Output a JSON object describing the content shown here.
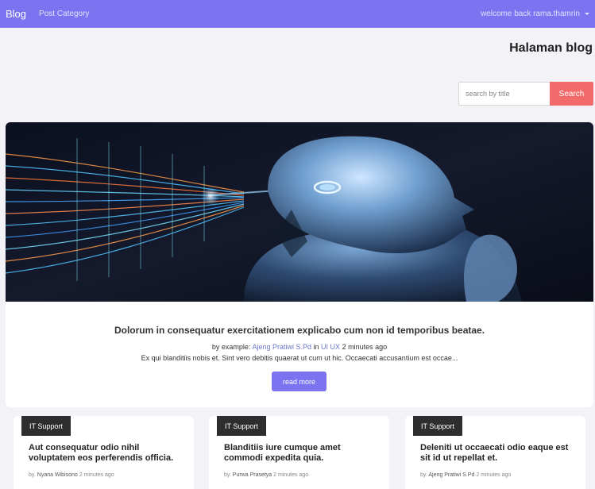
{
  "navbar": {
    "brand": "Blog",
    "links": [
      "Post Category"
    ],
    "user_greeting": "welcome back rama.thamrin"
  },
  "page": {
    "title": "Halaman blog"
  },
  "search": {
    "placeholder": "search by title",
    "button_label": "Search"
  },
  "featured": {
    "title": "Dolorum in consequatur exercitationem explicabo cum non id temporibus beatae.",
    "by_prefix": "by example:",
    "author": "Ajeng Pratiwi S.Pd",
    "in_word": "in",
    "category": "UI UX",
    "time": "2 minutes ago",
    "excerpt": "Ex qui blanditiis nobis et. Sint vero debitis quaerat ut cum ut hic. Occaecati accusantium est occae...",
    "read_more_label": "read more"
  },
  "cards": [
    {
      "category": "IT Support",
      "title": "Aut consequatur odio nihil voluptatem eos perferendis officia.",
      "by_prefix": "by.",
      "author": "Nyana Wibisono",
      "time": "2 minutes ago"
    },
    {
      "category": "IT Support",
      "title": "Blanditiis iure cumque amet commodi expedita quia.",
      "by_prefix": "by.",
      "author": "Purwa Prasetya",
      "time": "2 minutes ago"
    },
    {
      "category": "IT Support",
      "title": "Deleniti ut occaecati odio eaque est sit id ut repellat et.",
      "by_prefix": "by.",
      "author": "Ajeng Pratiwi S.Pd",
      "time": "2 minutes ago"
    }
  ],
  "colors": {
    "navbar": "#7b73f0",
    "search_button": "#f36a6a",
    "read_more": "#7b73f0",
    "badge": "#2e2e2e",
    "link": "#6b77c8"
  }
}
